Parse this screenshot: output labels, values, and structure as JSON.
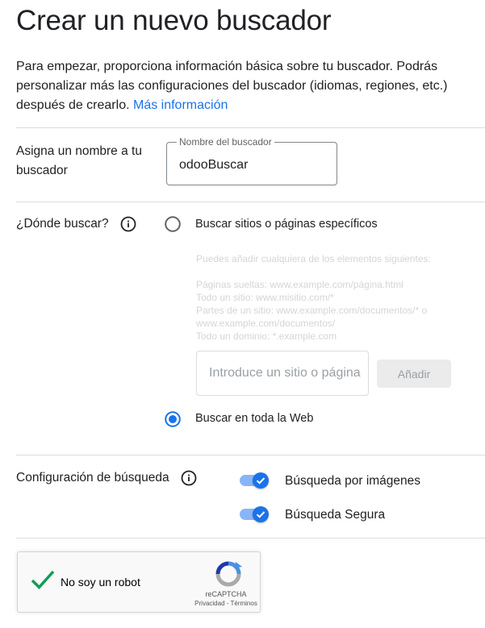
{
  "page": {
    "title": "Crear un nuevo buscador",
    "intro_text": "Para empezar, proporciona información básica sobre tu buscador. Podrás personalizar más las configuraciones del buscador (idiomas, regiones, etc.) después de crearlo.",
    "intro_link": "Más información"
  },
  "name_section": {
    "label": "Asigna un nombre a tu buscador",
    "field_legend": "Nombre del buscador",
    "field_value": "odooBuscar"
  },
  "where_section": {
    "label": "¿Dónde buscar?",
    "option_specific": "Buscar sitios o páginas específicos",
    "option_specific_selected": false,
    "hint_title": "Puedes añadir cualquiera de los elementos siguientes:",
    "hint_lines": [
      "Páginas sueltas: www.example.com/página.html",
      "Todo un sitio: www.misitio.com/*",
      "Partes de un sitio: www.example.com/documentos/* o",
      "www.example.com/documentos/",
      "Todo un dominio: *.example.com"
    ],
    "site_input_placeholder": "Introduce un sitio o página",
    "add_button": "Añadir",
    "option_web": "Buscar en toda la Web",
    "option_web_selected": true
  },
  "config_section": {
    "label": "Configuración de búsqueda",
    "toggles": [
      {
        "label": "Búsqueda por imágenes",
        "enabled": true
      },
      {
        "label": "Búsqueda Segura",
        "enabled": true
      }
    ]
  },
  "captcha": {
    "label": "No soy un robot",
    "checked": true,
    "brand": "reCAPTCHA",
    "links": "Privacidad - Términos"
  },
  "colors": {
    "accent": "#1a73e8",
    "text": "#202124",
    "divider": "#dadce0",
    "check_green": "#0f9d58"
  }
}
